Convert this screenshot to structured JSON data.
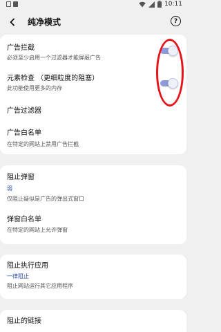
{
  "status_bar": {
    "time": "10:11"
  },
  "header": {
    "title": "纯净模式",
    "help_glyph": "?"
  },
  "ad_section": {
    "ad_block": {
      "title": "广告拦截",
      "subtitle": "必须至少启用一个过滤器才能屏蔽广告",
      "enabled": true
    },
    "element_check": {
      "title": "元素检查 （更细粒度的阻塞）",
      "subtitle": "此功能使用更多的内存",
      "enabled": true
    },
    "ad_filter": {
      "title": "广告过滤器"
    },
    "ad_whitelist": {
      "title": "广告白名单",
      "subtitle": "在特定的网站上禁用广告拦截"
    }
  },
  "popup_section": {
    "block_popup": {
      "title": "阻止弹窗",
      "value": "弱",
      "subtitle": "仅阻止疑似是广告的弹出式窗口"
    },
    "popup_whitelist": {
      "title": "弹窗白名单",
      "subtitle": "在特定的网站上允许弹窗"
    }
  },
  "app_section": {
    "block_app": {
      "title": "阻止执行应用",
      "value": "一律阻止",
      "subtitle": "阻止网站运行其它应用程序"
    }
  },
  "link_section": {
    "block_link": {
      "title": "阻止的链接"
    }
  },
  "colors": {
    "accent": "#2f4fa8",
    "toggle_track": "#8f9ad8",
    "annotation": "#e8141b"
  }
}
